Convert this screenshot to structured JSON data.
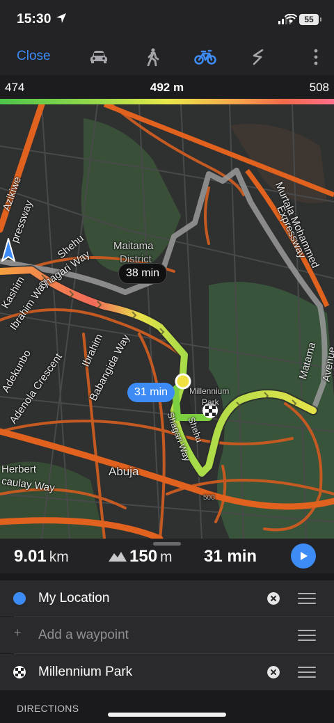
{
  "status": {
    "time": "15:30",
    "battery": "55"
  },
  "toolbar": {
    "close_label": "Close",
    "modes": [
      {
        "name": "car",
        "icon": "car-icon",
        "active": false
      },
      {
        "name": "walk",
        "icon": "walk-icon",
        "active": false
      },
      {
        "name": "bike",
        "icon": "bike-icon",
        "active": true
      },
      {
        "name": "other",
        "icon": "route-icon",
        "active": false
      }
    ],
    "accent": "#3d8bf5"
  },
  "elevation": {
    "min": "474",
    "current": "492 m",
    "max": "508"
  },
  "map": {
    "labels": {
      "maitama": "Maitama",
      "district": "District",
      "shehu1": "Shehu",
      "shagari_way": "Shagari Way",
      "ibrahim_way": "Ibrahim Way",
      "kashim": "Kashim",
      "ibrahim2": "Ibrahim",
      "babangida_way": "Babangida Way",
      "adekunbo": "Adekunbo",
      "adenola_crescent": "Adenola Crescent",
      "herbert": "Herbert",
      "caulay_way": "caulay Way",
      "abuja": "Abuja",
      "millennium": "Millennium",
      "park": "Park",
      "shagari2": "Shagari Way",
      "shehu2": "Shehu",
      "murtala": "Murtala Mohammed",
      "expressway": "Expressway",
      "matama": "Matama",
      "avenue": "Avenue",
      "azikiwe": "Azikiwe",
      "pressway": "pressway",
      "contour_500": "500"
    },
    "alt_route_time": "38 min",
    "route_time": "31 min"
  },
  "summary": {
    "distance": "9.01",
    "distance_unit": "km",
    "climb": "150",
    "climb_unit": "m",
    "time": "31 min"
  },
  "waypoints": {
    "start": "My Location",
    "add": "Add a waypoint",
    "end": "Millennium Park"
  },
  "directions_title": "DIRECTIONS"
}
